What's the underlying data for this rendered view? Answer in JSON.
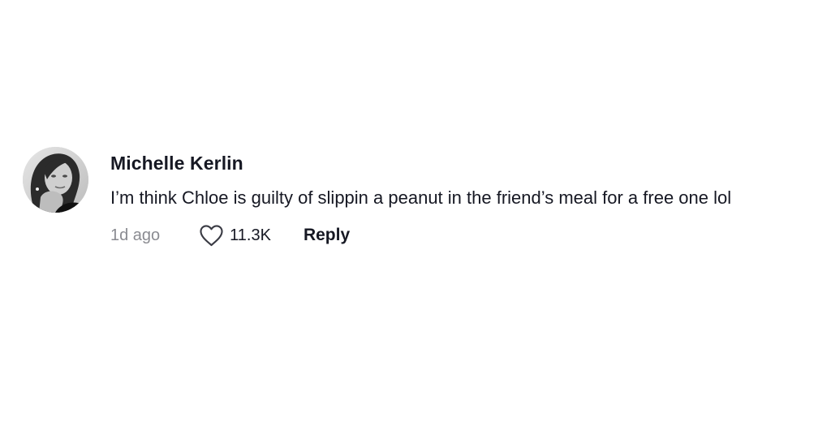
{
  "comment": {
    "username": "Michelle Kerlin",
    "text": "I’m think Chloe is guilty of slippin a peanut in the friend’s meal for a free one lol",
    "timestamp": "1d ago",
    "likes": "11.3K",
    "reply_label": "Reply",
    "avatar_icon": "user-avatar-photo",
    "like_icon": "heart-outline-icon"
  }
}
